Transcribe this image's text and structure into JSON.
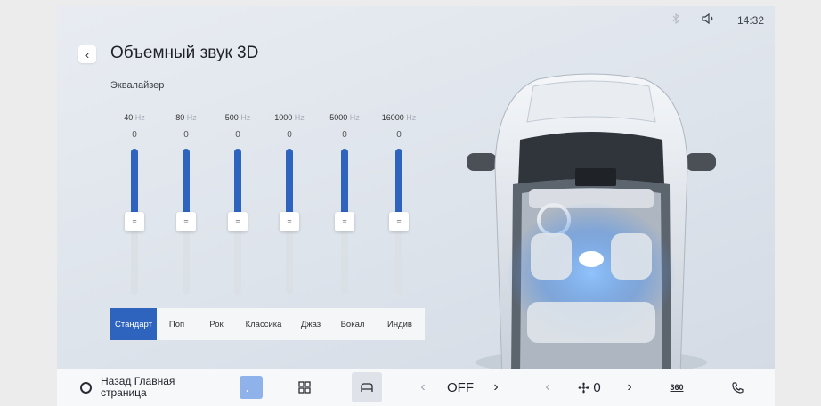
{
  "status": {
    "time": "14:32"
  },
  "header": {
    "title": "Объемный звук 3D",
    "section": "Эквалайзер"
  },
  "equalizer": {
    "bands": [
      {
        "freq": "40",
        "unit": "Hz",
        "value": "0",
        "level": 0.5
      },
      {
        "freq": "80",
        "unit": "Hz",
        "value": "0",
        "level": 0.5
      },
      {
        "freq": "500",
        "unit": "Hz",
        "value": "0",
        "level": 0.5
      },
      {
        "freq": "1000",
        "unit": "Hz",
        "value": "0",
        "level": 0.5
      },
      {
        "freq": "5000",
        "unit": "Hz",
        "value": "0",
        "level": 0.5
      },
      {
        "freq": "16000",
        "unit": "Hz",
        "value": "0",
        "level": 0.5
      }
    ],
    "presets": [
      "Стандарт",
      "Поп",
      "Рок",
      "Классика",
      "Джаз",
      "Вокал",
      "Индив"
    ],
    "active_preset": "Стандарт"
  },
  "bottom_bar": {
    "home_label_line1": "Назад Главная",
    "home_label_line2": "страница",
    "ac_value": "OFF",
    "fan_value": "0",
    "view_360": "360"
  },
  "colors": {
    "accent": "#2e64be",
    "music_button": "#8fb2ea"
  }
}
